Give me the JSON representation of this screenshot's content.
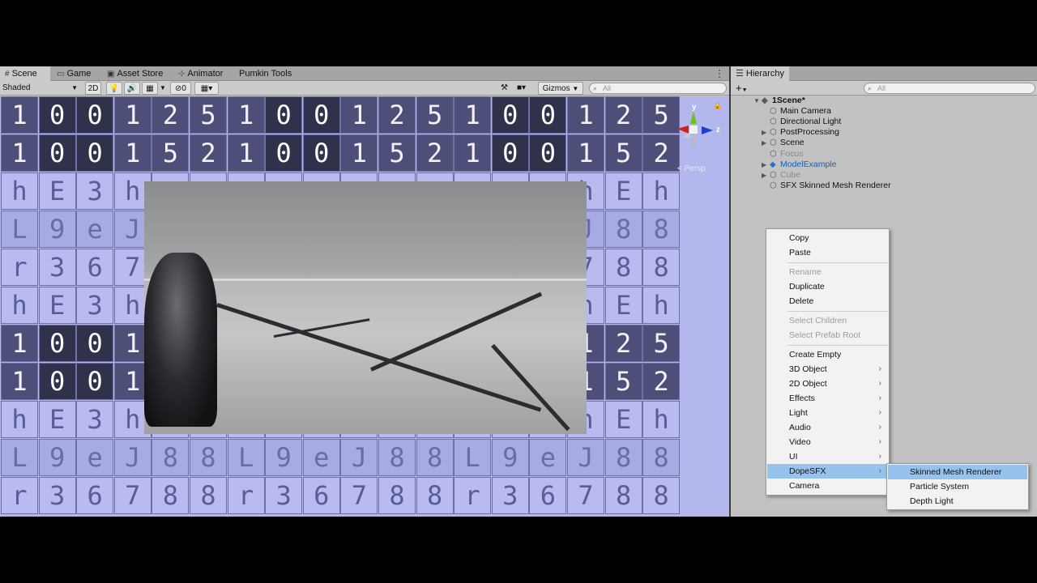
{
  "scene_tabs": {
    "tabs": [
      {
        "label": "Scene",
        "icon": "hash-icon"
      },
      {
        "label": "Game",
        "icon": "gamepad-icon"
      },
      {
        "label": "Asset Store",
        "icon": "store-icon"
      },
      {
        "label": "Animator",
        "icon": "animator-icon"
      },
      {
        "label": "Pumkin Tools",
        "icon": ""
      }
    ],
    "more": "⋮"
  },
  "scene_toolbar": {
    "shading_mode": "Shaded",
    "mode_2d": "2D",
    "hidden_count": "0",
    "gizmos_label": "Gizmos",
    "search_placeholder": "All"
  },
  "gizmo": {
    "y_label": "y",
    "z_label": "z",
    "projection": "< Persp"
  },
  "digit_rows": [
    [
      "1",
      "0",
      "0",
      "1",
      "2",
      "5",
      "1",
      "0",
      "0",
      "1",
      "2",
      "5",
      "1",
      "0",
      "0",
      "1",
      "2",
      "5"
    ],
    [
      "1",
      "0",
      "0",
      "1",
      "5",
      "2",
      "1",
      "0",
      "0",
      "1",
      "5",
      "2",
      "1",
      "0",
      "0",
      "1",
      "5",
      "2"
    ],
    [
      "h",
      "E",
      "3",
      "h",
      "",
      "",
      "",
      "",
      "",
      "",
      "",
      "",
      "",
      "",
      "",
      "h",
      "E",
      "h"
    ],
    [
      "L",
      "9",
      "e",
      "J",
      "",
      "",
      "",
      "",
      "",
      "",
      "",
      "",
      "",
      "",
      "",
      "J",
      "8",
      "8"
    ],
    [
      "r",
      "3",
      "6",
      "7",
      "",
      "",
      "",
      "",
      "",
      "",
      "",
      "",
      "",
      "",
      "",
      "7",
      "8",
      "8"
    ],
    [
      "h",
      "E",
      "3",
      "h",
      "",
      "",
      "",
      "",
      "",
      "",
      "",
      "",
      "",
      "",
      "",
      "h",
      "E",
      "h"
    ],
    [
      "1",
      "0",
      "0",
      "1",
      "",
      "",
      "",
      "",
      "",
      "",
      "",
      "",
      "",
      "",
      "",
      "1",
      "2",
      "5"
    ],
    [
      "1",
      "0",
      "0",
      "1",
      "",
      "",
      "",
      "",
      "",
      "",
      "",
      "",
      "",
      "",
      "",
      "1",
      "5",
      "2"
    ],
    [
      "h",
      "E",
      "3",
      "h",
      "",
      "",
      "",
      "",
      "",
      "",
      "",
      "",
      "",
      "",
      "",
      "h",
      "E",
      "h"
    ],
    [
      "L",
      "9",
      "e",
      "J",
      "8",
      "8",
      "L",
      "9",
      "e",
      "J",
      "8",
      "8",
      "L",
      "9",
      "e",
      "J",
      "8",
      "8"
    ],
    [
      "r",
      "3",
      "6",
      "7",
      "8",
      "8",
      "r",
      "3",
      "6",
      "7",
      "8",
      "8",
      "r",
      "3",
      "6",
      "7",
      "8",
      "8"
    ]
  ],
  "hierarchy": {
    "tab_label": "Hierarchy",
    "add_label": "+",
    "search_placeholder": "All",
    "items": [
      {
        "label": "1Scene*",
        "type": "scene"
      },
      {
        "label": "Main Camera",
        "type": "object"
      },
      {
        "label": "Directional Light",
        "type": "object"
      },
      {
        "label": "PostProcessing",
        "type": "object"
      },
      {
        "label": "Scene",
        "type": "object"
      },
      {
        "label": "Focus",
        "type": "disabled"
      },
      {
        "label": "ModelExample",
        "type": "prefab"
      },
      {
        "label": "Cube",
        "type": "disabled"
      },
      {
        "label": "SFX Skinned Mesh Renderer",
        "type": "object"
      }
    ]
  },
  "context_menu": {
    "items": [
      {
        "label": "Copy",
        "enabled": true
      },
      {
        "label": "Paste",
        "enabled": true
      },
      {
        "label": "Rename",
        "enabled": false
      },
      {
        "label": "Duplicate",
        "enabled": true
      },
      {
        "label": "Delete",
        "enabled": true
      },
      {
        "label": "Select Children",
        "enabled": false
      },
      {
        "label": "Select Prefab Root",
        "enabled": false
      },
      {
        "label": "Create Empty",
        "enabled": true
      },
      {
        "label": "3D Object",
        "enabled": true,
        "submenu": true
      },
      {
        "label": "2D Object",
        "enabled": true,
        "submenu": true
      },
      {
        "label": "Effects",
        "enabled": true,
        "submenu": true
      },
      {
        "label": "Light",
        "enabled": true,
        "submenu": true
      },
      {
        "label": "Audio",
        "enabled": true,
        "submenu": true
      },
      {
        "label": "Video",
        "enabled": true,
        "submenu": true
      },
      {
        "label": "UI",
        "enabled": true,
        "submenu": true
      },
      {
        "label": "DopeSFX",
        "enabled": true,
        "submenu": true,
        "highlighted": true
      },
      {
        "label": "Camera",
        "enabled": true
      }
    ]
  },
  "submenu": {
    "items": [
      {
        "label": "Skinned Mesh Renderer",
        "highlighted": true
      },
      {
        "label": "Particle System"
      },
      {
        "label": "Depth Light"
      }
    ]
  },
  "colors": {
    "menu_highlight": "#96c3ee",
    "prefab_text": "#1a5fb4",
    "gizmo_x": "#d32020",
    "gizmo_y": "#6fbf20",
    "gizmo_z": "#1d3fd6"
  }
}
